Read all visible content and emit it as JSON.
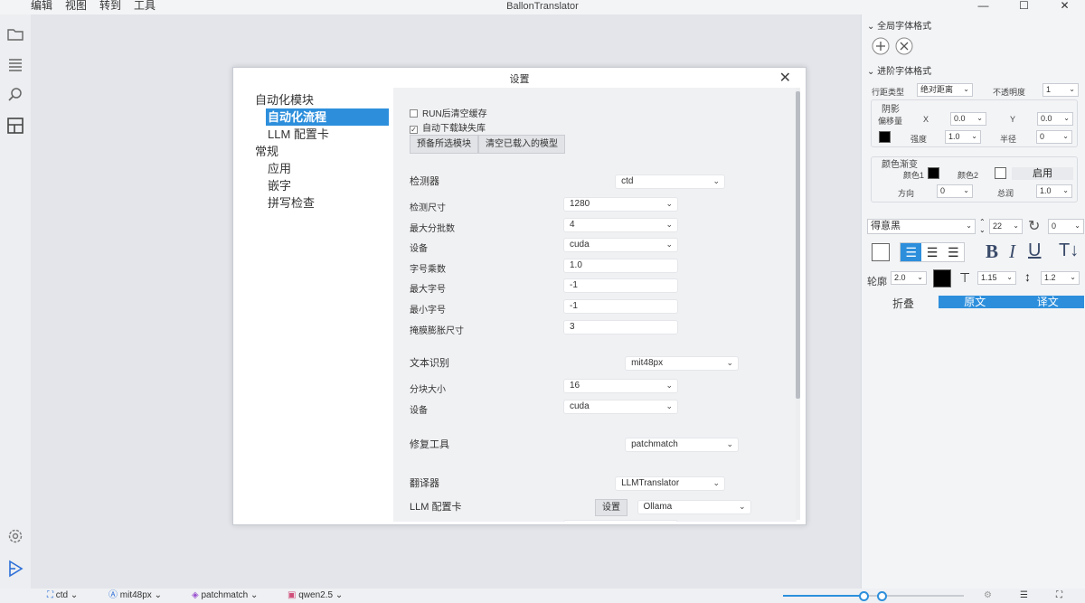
{
  "window": {
    "title": "BallonTranslator",
    "menu": [
      "编辑",
      "视图",
      "转到",
      "工具"
    ]
  },
  "dialog": {
    "title": "设置",
    "nav": [
      {
        "label": "自动化模块",
        "sub": false,
        "selected": false
      },
      {
        "label": "自动化流程",
        "sub": true,
        "selected": true
      },
      {
        "label": "LLM 配置卡",
        "sub": true,
        "selected": false
      },
      {
        "label": "常规",
        "sub": false,
        "selected": false
      },
      {
        "label": "应用",
        "sub": true,
        "selected": false
      },
      {
        "label": "嵌字",
        "sub": true,
        "selected": false
      },
      {
        "label": "拼写检查",
        "sub": true,
        "selected": false
      }
    ],
    "options": {
      "clear_cache": "RUN后清空缓存",
      "auto_download": "自动下载缺失库",
      "preload_btn": "预备所选模块",
      "unload_btn": "清空已载入的模型"
    },
    "detector": {
      "label": "检测器",
      "value": "ctd",
      "params": [
        {
          "label": "检测尺寸",
          "value": "1280",
          "dropdown": true
        },
        {
          "label": "最大分批数",
          "value": "4",
          "dropdown": true
        },
        {
          "label": "设备",
          "value": "cuda",
          "dropdown": true
        },
        {
          "label": "字号乘数",
          "value": "1.0",
          "dropdown": false
        },
        {
          "label": "最大字号",
          "value": "-1",
          "dropdown": false
        },
        {
          "label": "最小字号",
          "value": "-1",
          "dropdown": false
        },
        {
          "label": "掩膜膨胀尺寸",
          "value": "3",
          "dropdown": false
        }
      ]
    },
    "ocr": {
      "label": "文本识别",
      "value": "mit48px",
      "params": [
        {
          "label": "分块大小",
          "value": "16",
          "dropdown": true
        },
        {
          "label": "设备",
          "value": "cuda",
          "dropdown": true
        }
      ]
    },
    "inpaint": {
      "label": "修复工具",
      "value": "patchmatch"
    },
    "translator": {
      "label": "翻译器",
      "value": "LLMTranslator"
    },
    "llm": {
      "label": "LLM 配置卡",
      "value": "Ollama",
      "settings_btn": "设置"
    }
  },
  "right_panel": {
    "global_fmt": "全局字体格式",
    "adv_fmt": "进阶字体格式",
    "line_spacing_label": "行距类型",
    "line_spacing_value": "绝对距离",
    "opacity_label": "不透明度",
    "opacity_value": "1",
    "shadow": {
      "title": "阴影",
      "offset": "偏移量",
      "x_label": "X",
      "x": "0.0",
      "y_label": "Y",
      "y": "0.0",
      "strength_label": "强度",
      "strength": "1.0",
      "radius_label": "半径",
      "radius": "0"
    },
    "gradient": {
      "title": "颜色渐变",
      "c1": "颜色1",
      "c2": "颜色2",
      "enable": "启用",
      "dir_label": "方向",
      "dir": "0",
      "scale_label": "总润",
      "scale": "1.0"
    },
    "font": "得意黑",
    "font_size": "22",
    "rotation": "0",
    "stroke_label": "轮廓",
    "stroke": "2.0",
    "letter_spacing": "1.15",
    "line_spacing": "1.2",
    "fold": "折叠",
    "tab_source": "原文",
    "tab_trans": "译文"
  },
  "status": {
    "detector": "ctd",
    "ocr": "mit48px",
    "inpaint": "patchmatch",
    "translator": "qwen2.5"
  },
  "colors": {
    "accent": "#2d8fdc"
  }
}
